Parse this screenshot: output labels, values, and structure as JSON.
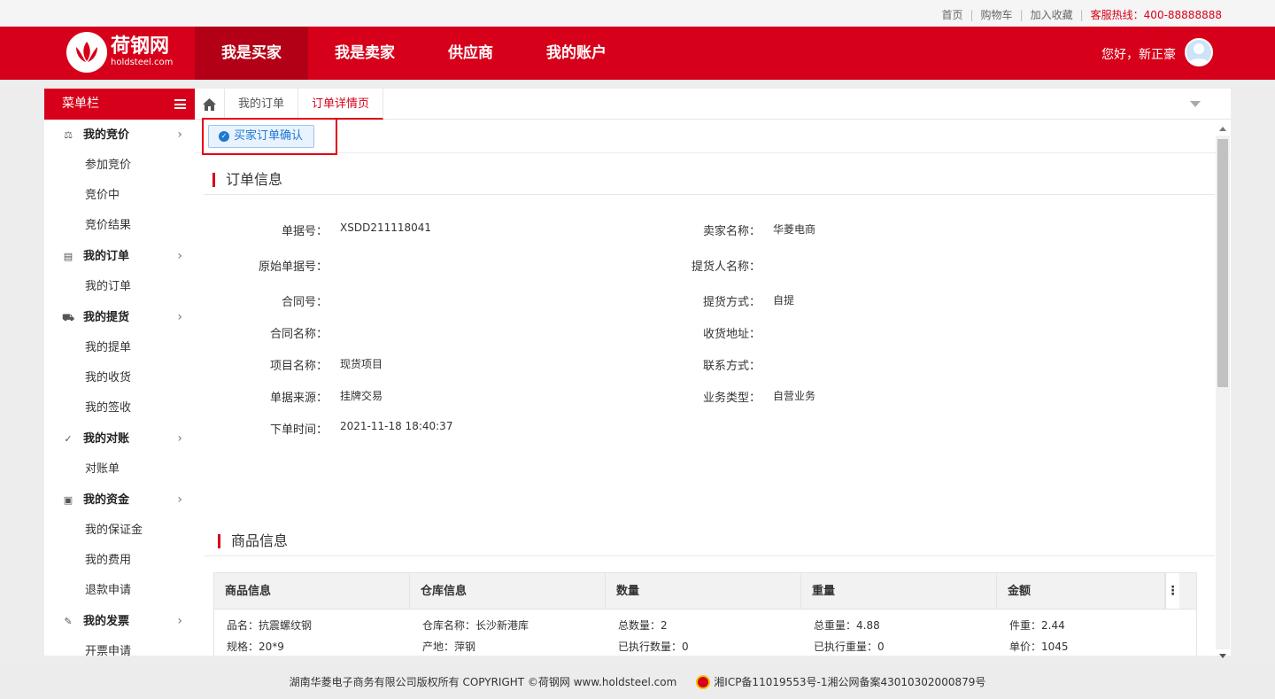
{
  "topbar": {
    "links": [
      "首页",
      "购物车",
      "加入收藏"
    ],
    "hotline": "客服热线：400-88888888"
  },
  "header": {
    "logo_cn": "荷钢网",
    "logo_en": "holdsteel.com",
    "nav": [
      "我是买家",
      "我是卖家",
      "供应商",
      "我的账户"
    ],
    "greeting": "您好，新正豪"
  },
  "sidebar": {
    "title": "菜单栏",
    "groups": [
      {
        "label": "我的竞价",
        "icon": "auction-icon",
        "items": [
          "参加竞价",
          "竞价中",
          "竞价结果"
        ]
      },
      {
        "label": "我的订单",
        "icon": "document-icon",
        "items": [
          "我的订单"
        ]
      },
      {
        "label": "我的提货",
        "icon": "truck-icon",
        "items": [
          "我的提单",
          "我的收货",
          "我的签收"
        ]
      },
      {
        "label": "我的对账",
        "icon": "check-circle-icon",
        "items": [
          "对账单"
        ]
      },
      {
        "label": "我的资金",
        "icon": "wallet-icon",
        "items": [
          "我的保证金",
          "我的费用",
          "退款申请"
        ]
      },
      {
        "label": "我的发票",
        "icon": "invoice-icon",
        "items": [
          "开票申请"
        ]
      }
    ]
  },
  "tabs": [
    "我的订单",
    "订单详情页"
  ],
  "toolbar": {
    "confirm_label": "买家订单确认"
  },
  "order_info": {
    "title": "订单信息",
    "left": [
      {
        "label": "单据号：",
        "value": "XSDD211118041"
      },
      {
        "label": "原始单据号：",
        "value": ""
      },
      {
        "label": "合同号：",
        "value": ""
      },
      {
        "label": "合同名称：",
        "value": ""
      },
      {
        "label": "项目名称：",
        "value": "现货项目"
      },
      {
        "label": "单据来源：",
        "value": "挂牌交易"
      },
      {
        "label": "下单时间：",
        "value": "2021-11-18 18:40:37"
      }
    ],
    "right": [
      {
        "label": "卖家名称：",
        "value": "华菱电商"
      },
      {
        "label": "提货人名称：",
        "value": ""
      },
      {
        "label": "提货方式：",
        "value": "自提"
      },
      {
        "label": "收货地址：",
        "value": ""
      },
      {
        "label": "联系方式：",
        "value": ""
      },
      {
        "label": "业务类型：",
        "value": "自营业务"
      }
    ]
  },
  "goods_info": {
    "title": "商品信息",
    "columns": [
      "商品信息",
      "仓库信息",
      "数量",
      "重量",
      "金额"
    ],
    "row": [
      [
        "品名：抗震螺纹钢",
        "规格：20*9"
      ],
      [
        "仓库名称：长沙新港库",
        "产地：萍钢"
      ],
      [
        "总数量：2",
        "已执行数量：0"
      ],
      [
        "总重量：4.88",
        "已执行重量：0"
      ],
      [
        "件重：2.44",
        "单价：1045"
      ]
    ]
  },
  "footer": {
    "copyright": "湖南华菱电子商务有限公司版权所有 COPYRIGHT ©荷钢网 www.holdsteel.com",
    "icp": "湘ICP备11019553号-1湘公网备案43010302000879号"
  },
  "colors": {
    "brand": "#d7001a",
    "accent_blue": "#1e78d2"
  }
}
